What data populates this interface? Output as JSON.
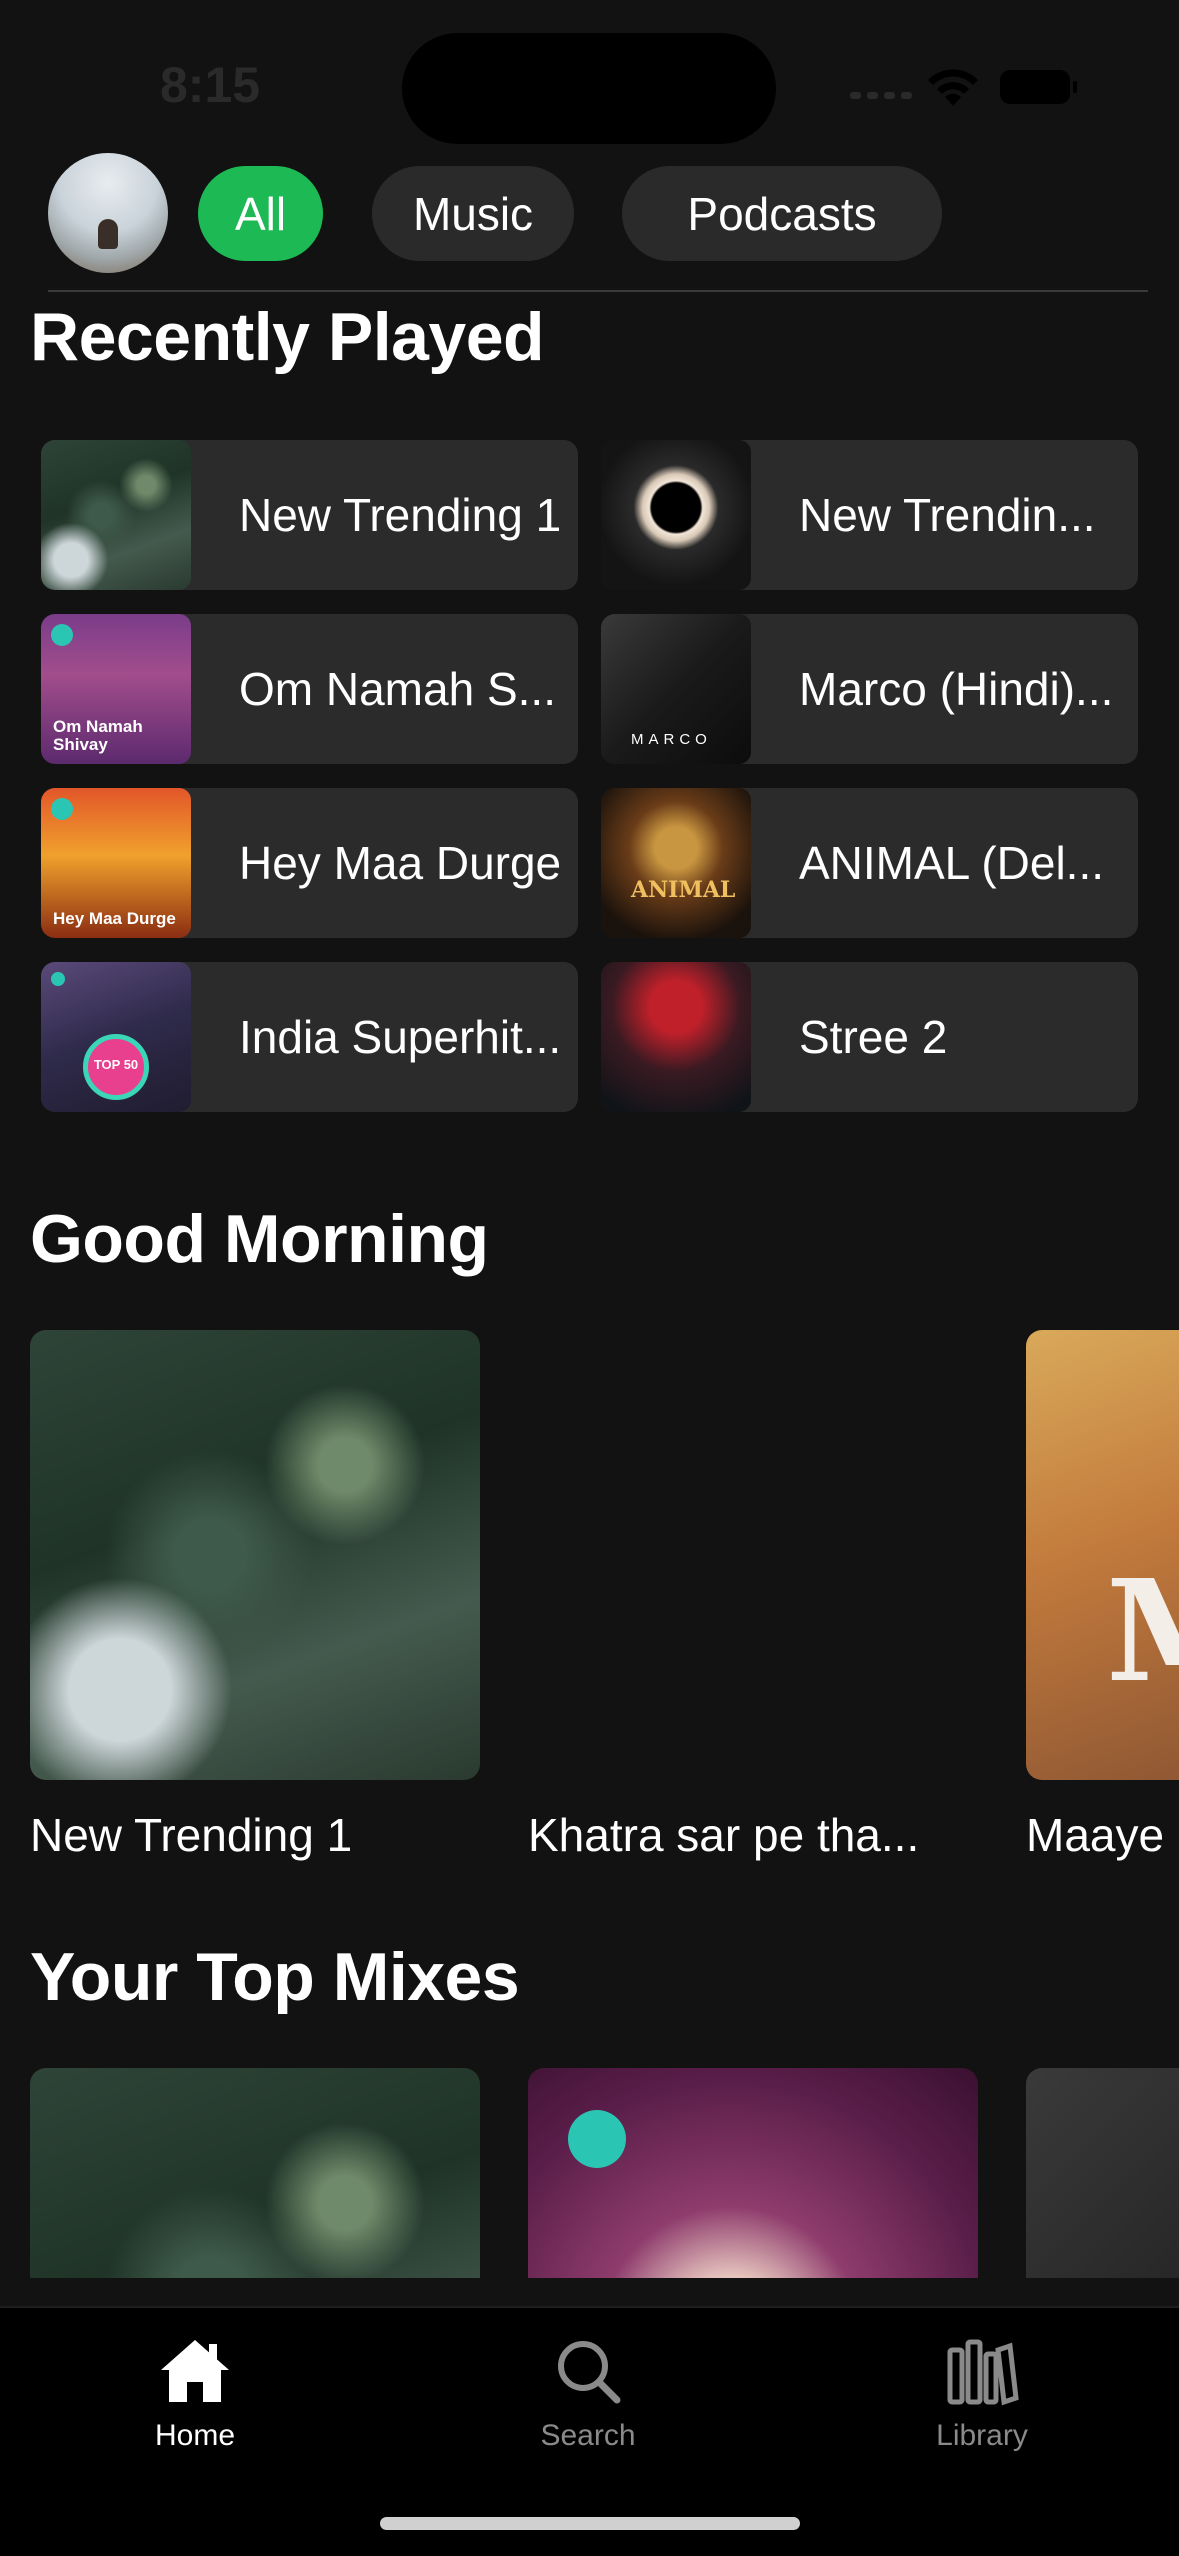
{
  "status_bar": {
    "time": "8:15"
  },
  "filters": {
    "chips": [
      "All",
      "Music",
      "Podcasts"
    ],
    "selected": "All",
    "accent_color": "#1db954"
  },
  "sections": {
    "recently_played": {
      "title": "Recently Played",
      "items": [
        {
          "label": "New Trending 1",
          "art": "forest"
        },
        {
          "label": "New Trendin...",
          "art": "ring"
        },
        {
          "label": "Om Namah S...",
          "art": "shiva",
          "art_text": "Om Namah Shivay"
        },
        {
          "label": "Marco (Hindi)...",
          "art": "marco",
          "art_text": "MARCO"
        },
        {
          "label": "Hey Maa Durge",
          "art": "durga",
          "art_text": "Hey Maa Durge"
        },
        {
          "label": "ANIMAL (Del...",
          "art": "animal",
          "art_text": "ANIMAL"
        },
        {
          "label": "India Superhit...",
          "art": "superhits",
          "art_text": "TOP 50"
        },
        {
          "label": "Stree 2",
          "art": "stree"
        }
      ]
    },
    "good_morning": {
      "title": "Good Morning",
      "items": [
        {
          "label": "New Trending 1",
          "art": "forest"
        },
        {
          "label": "Khatra sar pe tha...",
          "art": "none"
        },
        {
          "label": "Maaye",
          "art": "maaye",
          "art_text": "M"
        }
      ]
    },
    "top_mixes": {
      "title": "Your Top Mixes",
      "items": [
        {
          "art": "forest"
        },
        {
          "art": "shiva"
        },
        {
          "art": "dark"
        }
      ]
    }
  },
  "bottom_nav": {
    "items": [
      {
        "label": "Home",
        "icon": "home-icon",
        "active": true
      },
      {
        "label": "Search",
        "icon": "search-icon",
        "active": false
      },
      {
        "label": "Library",
        "icon": "library-icon",
        "active": false
      }
    ]
  }
}
